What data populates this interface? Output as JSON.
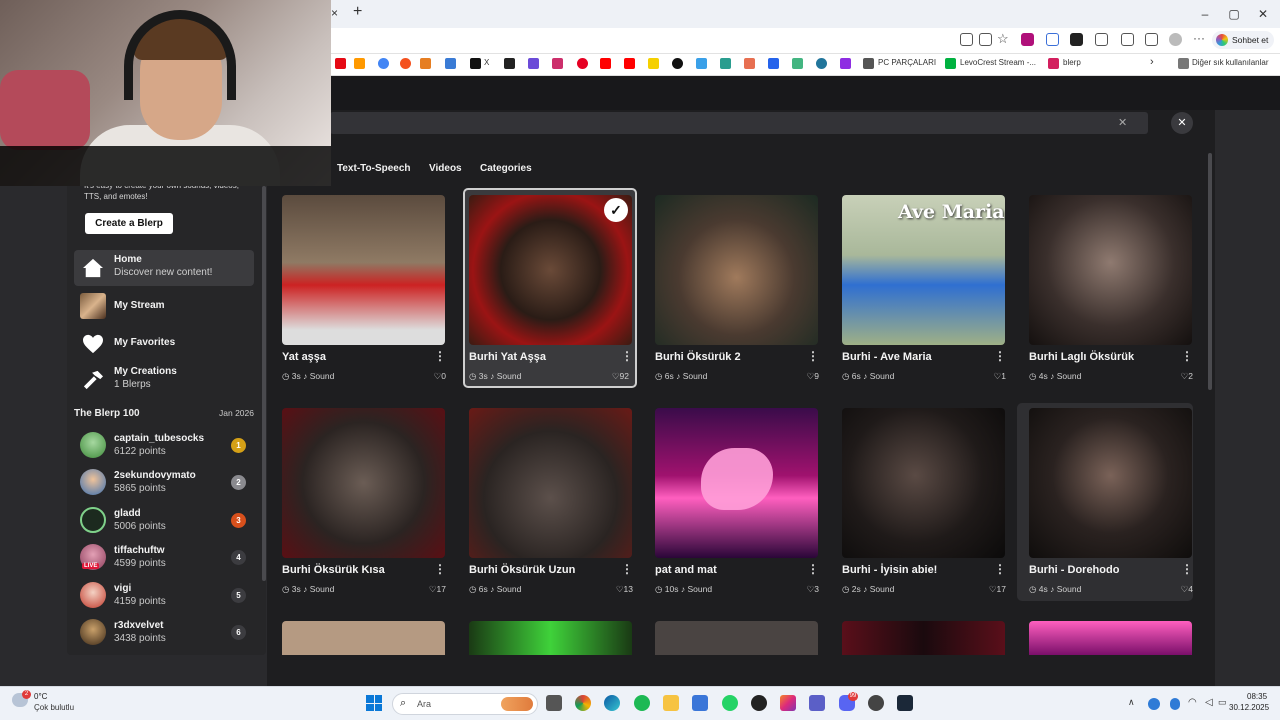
{
  "browser": {
    "new_tab": "+",
    "close_tab": "×",
    "window_controls": [
      "–",
      "▢",
      "✕"
    ],
    "copilot_label": "Sohbet et",
    "bookmarks": {
      "x_label": "X",
      "pc_parts": "PC PARÇALARI",
      "levocrest": "LevoCrest Stream -...",
      "blerp": "blerp",
      "other": "Diğer sık kullanılanlar",
      "more": "›"
    }
  },
  "modal": {
    "close": "✕",
    "clear": "✕",
    "tabs": [
      "Text-To-Speech",
      "Videos",
      "Categories"
    ]
  },
  "sidebar": {
    "promo_text": "It's easy to create your own sounds, videos, TTS, and emotes!",
    "create_button": "Create a Blerp",
    "nav": [
      {
        "title": "Home",
        "subtitle": "Discover new content!",
        "icon": "home-icon"
      },
      {
        "title": "My Stream",
        "subtitle": "",
        "icon": "stream-thumbnail-icon"
      },
      {
        "title": "My Favorites",
        "subtitle": "",
        "icon": "heart-icon"
      },
      {
        "title": "My Creations",
        "subtitle": "1 Blerps",
        "icon": "hammer-icon"
      }
    ],
    "leaderboard_title": "The Blerp 100",
    "leaderboard_date": "Jan 2026",
    "leaderboard": [
      {
        "name": "captain_tubesocks",
        "points": "6122 points",
        "rank": "1",
        "color": "#d4a017"
      },
      {
        "name": "2sekundovymato",
        "points": "5865 points",
        "rank": "2",
        "color": "#8a8a8f"
      },
      {
        "name": "gladd",
        "points": "5006 points",
        "rank": "3",
        "color": "#d8501c"
      },
      {
        "name": "tiffachuftw",
        "points": "4599 points",
        "rank": "4",
        "color": "#3c3c40"
      },
      {
        "name": "vigi",
        "points": "4159 points",
        "rank": "5",
        "color": "#3c3c40"
      },
      {
        "name": "r3dxvelvet",
        "points": "3438 points",
        "rank": "6",
        "color": "#3c3c40"
      }
    ],
    "live_badge": "LIVE"
  },
  "cards": [
    {
      "title": "Yat aşşa",
      "duration": "3s",
      "type": "Sound",
      "likes": "0"
    },
    {
      "title": "Burhi Yat Aşşa",
      "duration": "3s",
      "type": "Sound",
      "likes": "92"
    },
    {
      "title": "Burhi Öksürük 2",
      "duration": "6s",
      "type": "Sound",
      "likes": "9"
    },
    {
      "title": "Burhi - Ave Maria",
      "duration": "6s",
      "type": "Sound",
      "likes": "1"
    },
    {
      "title": "Burhi Laglı Öksürük",
      "duration": "4s",
      "type": "Sound",
      "likes": "2"
    },
    {
      "title": "Burhi Öksürük Kısa",
      "duration": "3s",
      "type": "Sound",
      "likes": "17"
    },
    {
      "title": "Burhi Öksürük Uzun",
      "duration": "6s",
      "type": "Sound",
      "likes": "13"
    },
    {
      "title": "pat and mat",
      "duration": "10s",
      "type": "Sound",
      "likes": "3"
    },
    {
      "title": "Burhi - İyisin abie!",
      "duration": "2s",
      "type": "Sound",
      "likes": "17"
    },
    {
      "title": "Burhi - Dorehodo",
      "duration": "4s",
      "type": "Sound",
      "likes": "4"
    }
  ],
  "thumb_text": {
    "ave_maria": "Ave Maria"
  },
  "taskbar": {
    "weather_temp": "0°C",
    "weather_desc": "Çok bulutlu",
    "weather_badge": "2",
    "search_placeholder": "Ara",
    "time": "08:35",
    "date": "30.12.2025",
    "discord_badge": "99"
  },
  "colors": {
    "selected_border": "#cfcfcf",
    "page_bg": "#1e1e20"
  }
}
